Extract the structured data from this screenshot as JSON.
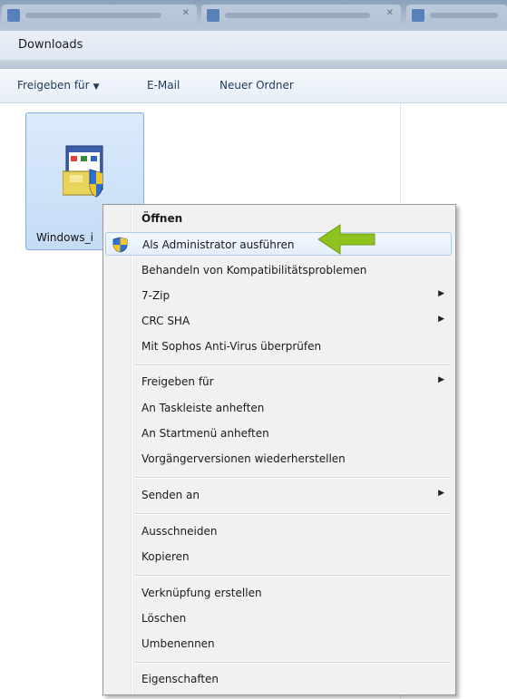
{
  "window": {
    "title": "Downloads"
  },
  "toolbar": {
    "share_label": "Freigeben für",
    "email_label": "E-Mail",
    "new_folder_label": "Neuer Ordner"
  },
  "file": {
    "label": "Windows_i"
  },
  "context_menu": {
    "open": "Öffnen",
    "run_as_admin": "Als Administrator ausführen",
    "troubleshoot_compat": "Behandeln von Kompatibilitätsproblemen",
    "zip": "7-Zip",
    "crc_sha": "CRC SHA",
    "sophos_scan": "Mit Sophos Anti-Virus überprüfen",
    "share_with": "Freigeben für",
    "pin_taskbar": "An Taskleiste anheften",
    "pin_start": "An Startmenü anheften",
    "restore_previous": "Vorgängerversionen wiederherstellen",
    "send_to": "Senden an",
    "cut": "Ausschneiden",
    "copy": "Kopieren",
    "create_shortcut": "Verknüpfung erstellen",
    "delete": "Löschen",
    "rename": "Umbenennen",
    "properties": "Eigenschaften"
  },
  "icons": {
    "submenu": "submenu-arrow-icon",
    "shield": "uac-shield-icon",
    "pointer": "green-arrow-icon"
  },
  "colors": {
    "highlight_border": "#aecbee",
    "menu_bg": "#f1f1f1",
    "annotation_arrow": "#8dc21f"
  }
}
